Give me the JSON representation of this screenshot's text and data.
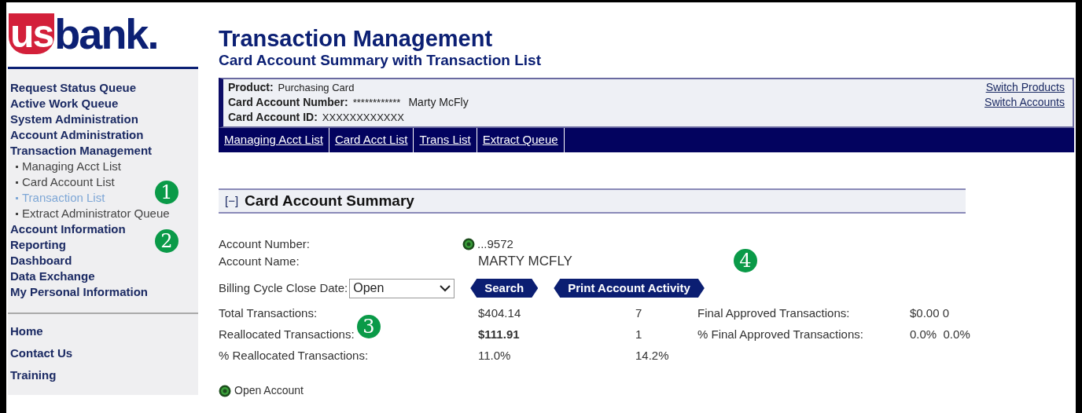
{
  "logo": {
    "mark": "us",
    "word": "bank."
  },
  "sidebar": {
    "items": [
      {
        "label": "Request Status Queue"
      },
      {
        "label": "Active Work Queue"
      },
      {
        "label": "System Administration"
      },
      {
        "label": "Account Administration"
      },
      {
        "label": "Transaction Management",
        "children": [
          {
            "label": "Managing Acct List",
            "selected": false
          },
          {
            "label": "Card Account List",
            "selected": false
          },
          {
            "label": "Transaction List",
            "selected": true
          },
          {
            "label": "Extract Administrator Queue",
            "selected": false
          }
        ]
      },
      {
        "label": "Account Information"
      },
      {
        "label": "Reporting"
      },
      {
        "label": "Dashboard"
      },
      {
        "label": "Data Exchange"
      },
      {
        "label": "My Personal Information"
      }
    ],
    "footer_items": [
      "Home",
      "Contact Us",
      "Training"
    ]
  },
  "title": "Transaction Management",
  "subtitle": "Card Account Summary with Transaction List",
  "account_card": {
    "fields": [
      {
        "label": "Product:",
        "value": "Purchasing Card"
      },
      {
        "label": "Card Account Number:",
        "value": "************",
        "extra": "Marty McFly"
      },
      {
        "label": "Card Account ID:",
        "value": "XXXXXXXXXXXX"
      }
    ],
    "links": [
      "Switch Products",
      "Switch Accounts"
    ],
    "nav": [
      "Managing Acct List",
      "Card Acct List",
      "Trans List",
      "Extract Queue"
    ]
  },
  "summary": {
    "toggle": "[−]",
    "title": "Card Account Summary",
    "expanded": true,
    "account_number_label": "Account Number:",
    "account_number": "...9572",
    "account_name_label": "Account Name:",
    "account_name": "MARTY MCFLY",
    "billing_label": "Billing Cycle Close Date:",
    "billing_value": "Open",
    "buttons": [
      "Search",
      "Print Account Activity"
    ],
    "stats": [
      {
        "label": "Total Transactions:",
        "amount": "$404.14",
        "bold": false,
        "count": "7",
        "side_label": "Final Approved Transactions:",
        "side_value": "$0.00 0"
      },
      {
        "label": "Reallocated Transactions:",
        "amount": "$111.91",
        "bold": true,
        "count": "1",
        "side_label": "% Final Approved Transactions:",
        "side_value": "0.0%  0.0%"
      },
      {
        "label": "% Reallocated Transactions:",
        "amount": "11.0%",
        "bold": false,
        "count": "14.2%"
      }
    ],
    "legend": "Open Account"
  },
  "callouts": [
    "1",
    "2",
    "3",
    "4"
  ]
}
